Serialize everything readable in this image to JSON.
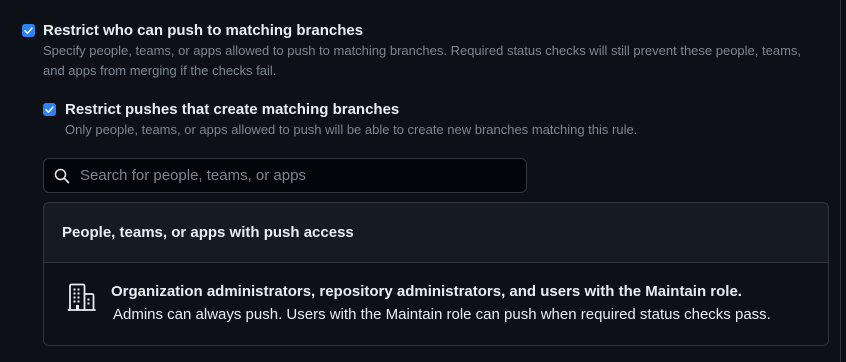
{
  "restrict_push": {
    "checked": true,
    "label": "Restrict who can push to matching branches",
    "description_line1": "Specify people, teams, or apps allowed to push to matching branches. Required status checks will still prevent these people, teams,",
    "description_line2": "and apps from merging if the checks fail."
  },
  "restrict_create": {
    "checked": true,
    "label": "Restrict pushes that create matching branches",
    "description": "Only people, teams, or apps allowed to push will be able to create new branches matching this rule."
  },
  "search": {
    "placeholder": "Search for people, teams, or apps",
    "icon": "search-icon"
  },
  "push_access": {
    "header": "People, teams, or apps with push access",
    "item": {
      "icon": "organization-icon",
      "title": "Organization administrators, repository administrators, and users with the Maintain role.",
      "description": "Admins can always push. Users with the Maintain role can push when required status checks pass."
    }
  },
  "colors": {
    "background": "#0d1117",
    "accent": "#2f81f7",
    "muted_text": "#7d8590",
    "border": "#30363d"
  }
}
